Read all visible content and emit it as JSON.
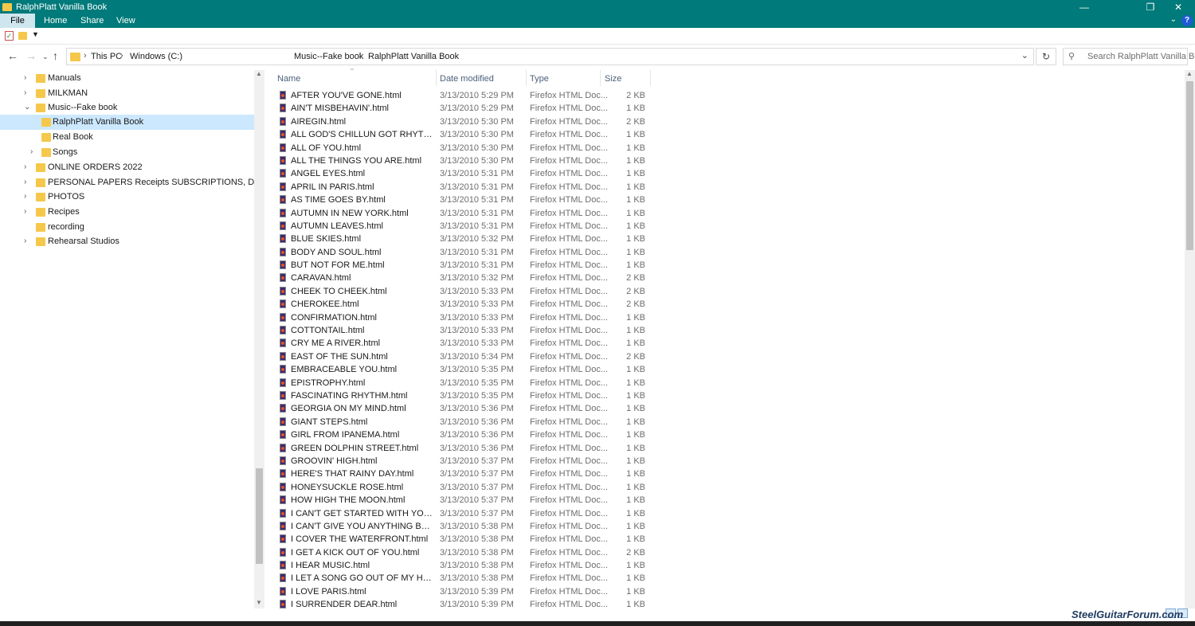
{
  "window": {
    "title": "RalphPlatt  Vanilla Book"
  },
  "ribbon": {
    "tabs": [
      "File",
      "Home",
      "Share",
      "View"
    ],
    "help": "?"
  },
  "address": {
    "crumbs": [
      "This PC",
      "Windows (C:)",
      "Music--Fake book",
      "RalphPlatt  Vanilla Book"
    ]
  },
  "search": {
    "placeholder": "Search RalphPlatt  Vanilla Bo..."
  },
  "tree": [
    {
      "label": "Manuals",
      "chev": "›"
    },
    {
      "label": "MILKMAN",
      "chev": "›"
    },
    {
      "label": "Music--Fake book",
      "chev": "⌄"
    },
    {
      "label": "RalphPlatt  Vanilla Book",
      "chev": ""
    },
    {
      "label": "Real Book",
      "chev": ""
    },
    {
      "label": "Songs",
      "chev": "›"
    },
    {
      "label": "ONLINE ORDERS 2022",
      "chev": "›"
    },
    {
      "label": "PERSONAL PAPERS Receipts SUBSCRIPTIONS, DOCUMENTS",
      "chev": "›"
    },
    {
      "label": "PHOTOS",
      "chev": "›"
    },
    {
      "label": "Recipes",
      "chev": "›"
    },
    {
      "label": "recording",
      "chev": ""
    },
    {
      "label": "Rehearsal Studios",
      "chev": "›"
    }
  ],
  "columns": [
    "Name",
    "Date modified",
    "Type",
    "Size"
  ],
  "files": [
    [
      "AFTER YOU'VE GONE.html",
      "3/13/2010 5:29 PM",
      "Firefox HTML Doc...",
      "2 KB"
    ],
    [
      "AIN'T MISBEHAVIN'.html",
      "3/13/2010 5:29 PM",
      "Firefox HTML Doc...",
      "1 KB"
    ],
    [
      "AIREGIN.html",
      "3/13/2010 5:30 PM",
      "Firefox HTML Doc...",
      "2 KB"
    ],
    [
      "ALL GOD'S CHILLUN GOT RHYTHM.html",
      "3/13/2010 5:30 PM",
      "Firefox HTML Doc...",
      "1 KB"
    ],
    [
      "ALL OF YOU.html",
      "3/13/2010 5:30 PM",
      "Firefox HTML Doc...",
      "1 KB"
    ],
    [
      "ALL THE THINGS YOU ARE.html",
      "3/13/2010 5:30 PM",
      "Firefox HTML Doc...",
      "1 KB"
    ],
    [
      "ANGEL EYES.html",
      "3/13/2010 5:31 PM",
      "Firefox HTML Doc...",
      "1 KB"
    ],
    [
      "APRIL IN PARIS.html",
      "3/13/2010 5:31 PM",
      "Firefox HTML Doc...",
      "1 KB"
    ],
    [
      "AS TIME GOES BY.html",
      "3/13/2010 5:31 PM",
      "Firefox HTML Doc...",
      "1 KB"
    ],
    [
      "AUTUMN IN NEW YORK.html",
      "3/13/2010 5:31 PM",
      "Firefox HTML Doc...",
      "1 KB"
    ],
    [
      "AUTUMN LEAVES.html",
      "3/13/2010 5:31 PM",
      "Firefox HTML Doc...",
      "1 KB"
    ],
    [
      "BLUE SKIES.html",
      "3/13/2010 5:32 PM",
      "Firefox HTML Doc...",
      "1 KB"
    ],
    [
      "BODY AND SOUL.html",
      "3/13/2010 5:31 PM",
      "Firefox HTML Doc...",
      "1 KB"
    ],
    [
      "BUT NOT FOR ME.html",
      "3/13/2010 5:31 PM",
      "Firefox HTML Doc...",
      "1 KB"
    ],
    [
      "CARAVAN.html",
      "3/13/2010 5:32 PM",
      "Firefox HTML Doc...",
      "2 KB"
    ],
    [
      "CHEEK TO CHEEK.html",
      "3/13/2010 5:33 PM",
      "Firefox HTML Doc...",
      "2 KB"
    ],
    [
      "CHEROKEE.html",
      "3/13/2010 5:33 PM",
      "Firefox HTML Doc...",
      "2 KB"
    ],
    [
      "CONFIRMATION.html",
      "3/13/2010 5:33 PM",
      "Firefox HTML Doc...",
      "1 KB"
    ],
    [
      "COTTONTAIL.html",
      "3/13/2010 5:33 PM",
      "Firefox HTML Doc...",
      "1 KB"
    ],
    [
      "CRY ME A RIVER.html",
      "3/13/2010 5:33 PM",
      "Firefox HTML Doc...",
      "1 KB"
    ],
    [
      "EAST OF THE SUN.html",
      "3/13/2010 5:34 PM",
      "Firefox HTML Doc...",
      "2 KB"
    ],
    [
      "EMBRACEABLE YOU.html",
      "3/13/2010 5:35 PM",
      "Firefox HTML Doc...",
      "1 KB"
    ],
    [
      "EPISTROPHY.html",
      "3/13/2010 5:35 PM",
      "Firefox HTML Doc...",
      "1 KB"
    ],
    [
      "FASCINATING RHYTHM.html",
      "3/13/2010 5:35 PM",
      "Firefox HTML Doc...",
      "1 KB"
    ],
    [
      "GEORGIA ON MY MIND.html",
      "3/13/2010 5:36 PM",
      "Firefox HTML Doc...",
      "1 KB"
    ],
    [
      "GIANT STEPS.html",
      "3/13/2010 5:36 PM",
      "Firefox HTML Doc...",
      "1 KB"
    ],
    [
      "GIRL FROM IPANEMA.html",
      "3/13/2010 5:36 PM",
      "Firefox HTML Doc...",
      "1 KB"
    ],
    [
      "GREEN DOLPHIN STREET.html",
      "3/13/2010 5:36 PM",
      "Firefox HTML Doc...",
      "1 KB"
    ],
    [
      "GROOVIN' HIGH.html",
      "3/13/2010 5:37 PM",
      "Firefox HTML Doc...",
      "1 KB"
    ],
    [
      "HERE'S THAT RAINY DAY.html",
      "3/13/2010 5:37 PM",
      "Firefox HTML Doc...",
      "1 KB"
    ],
    [
      "HONEYSUCKLE ROSE.html",
      "3/13/2010 5:37 PM",
      "Firefox HTML Doc...",
      "1 KB"
    ],
    [
      "HOW HIGH THE MOON.html",
      "3/13/2010 5:37 PM",
      "Firefox HTML Doc...",
      "1 KB"
    ],
    [
      "I CAN'T GET STARTED WITH YOU.html",
      "3/13/2010 5:37 PM",
      "Firefox HTML Doc...",
      "1 KB"
    ],
    [
      "I CAN'T GIVE YOU ANYTHING BUT LOVE....",
      "3/13/2010 5:38 PM",
      "Firefox HTML Doc...",
      "1 KB"
    ],
    [
      "I COVER THE WATERFRONT.html",
      "3/13/2010 5:38 PM",
      "Firefox HTML Doc...",
      "1 KB"
    ],
    [
      "I GET A KICK OUT OF YOU.html",
      "3/13/2010 5:38 PM",
      "Firefox HTML Doc...",
      "2 KB"
    ],
    [
      "I HEAR MUSIC.html",
      "3/13/2010 5:38 PM",
      "Firefox HTML Doc...",
      "1 KB"
    ],
    [
      "I LET A SONG GO OUT OF MY HEART.html",
      "3/13/2010 5:38 PM",
      "Firefox HTML Doc...",
      "1 KB"
    ],
    [
      "I LOVE PARIS.html",
      "3/13/2010 5:39 PM",
      "Firefox HTML Doc...",
      "1 KB"
    ],
    [
      "I SURRENDER DEAR.html",
      "3/13/2010 5:39 PM",
      "Firefox HTML Doc...",
      "1 KB"
    ]
  ],
  "watermark": "SteelGuitarForum.com"
}
